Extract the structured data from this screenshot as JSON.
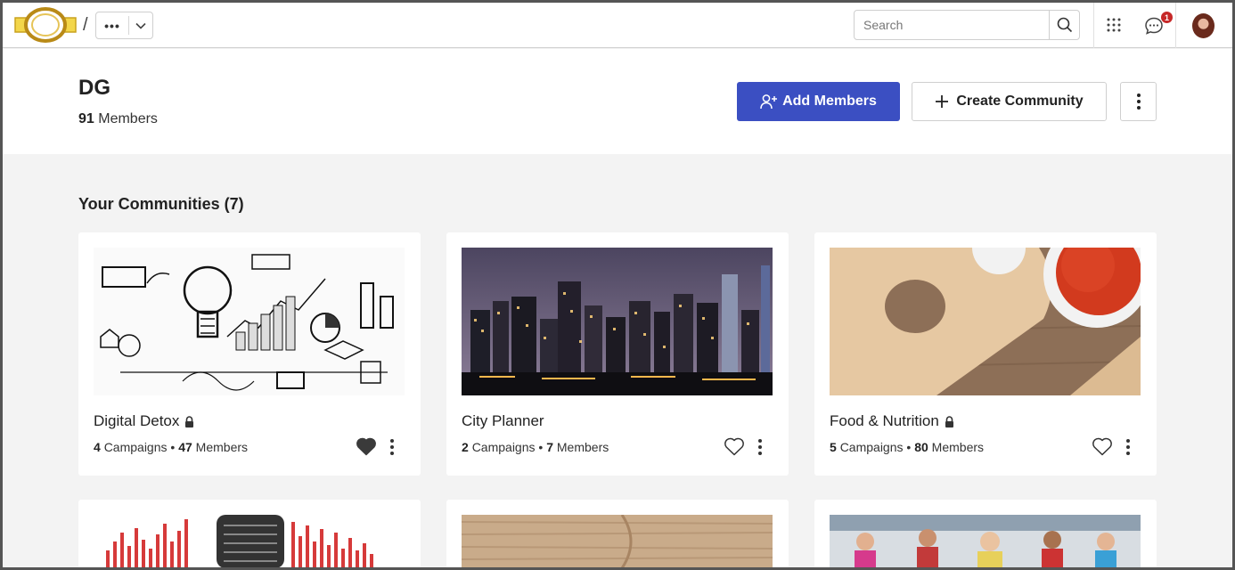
{
  "topbar": {
    "breadcrumb_separator": "/",
    "breadcrumb_more": "•••",
    "search_placeholder": "Search",
    "notification_count": "1"
  },
  "header": {
    "title": "DG",
    "member_count": "91",
    "member_label": "Members",
    "add_members_label": "Add Members",
    "create_community_label": "Create Community"
  },
  "communities": {
    "section_title": "Your Communities (7)",
    "cards": [
      {
        "name": "Digital Detox",
        "locked": true,
        "campaigns": "4",
        "campaigns_label": "Campaigns",
        "members": "47",
        "members_label": "Members",
        "favorited": true
      },
      {
        "name": "City Planner",
        "locked": false,
        "campaigns": "2",
        "campaigns_label": "Campaigns",
        "members": "7",
        "members_label": "Members",
        "favorited": false
      },
      {
        "name": "Food & Nutrition",
        "locked": true,
        "campaigns": "5",
        "campaigns_label": "Campaigns",
        "members": "80",
        "members_label": "Members",
        "favorited": false
      }
    ]
  },
  "colors": {
    "primary": "#3b4fc2",
    "page_bg": "#f3f3f3",
    "badge": "#c62828"
  }
}
